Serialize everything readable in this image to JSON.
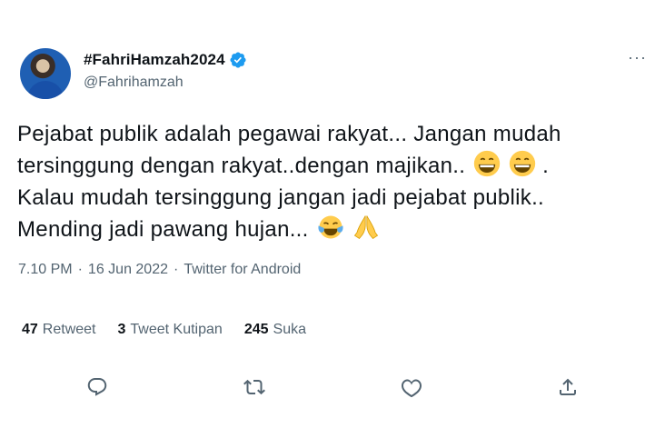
{
  "user": {
    "display_name": "#FahriHamzah2024",
    "handle": "@Fahrihamzah"
  },
  "tweet": {
    "lines": [
      "Pejabat publik adalah pegawai rakyat... Jangan mudah",
      "tersinggung dengan rakyat..dengan majikan..",
      "Kalau mudah tersinggung jangan jadi pejabat publik..",
      "Mending jadi pawang hujan..."
    ],
    "line2_suffix": "."
  },
  "meta": {
    "time": "7.10 PM",
    "sep1": "·",
    "date": "16 Jun 2022",
    "sep2": "·",
    "source": "Twitter for Android"
  },
  "stats": {
    "retweets": {
      "count": "47",
      "label": "Retweet"
    },
    "quotes": {
      "count": "3",
      "label": "Tweet Kutipan"
    },
    "likes": {
      "count": "245",
      "label": "Suka"
    }
  },
  "icons": {
    "verified": "verified-badge-icon",
    "more": "more-options-icon",
    "reply": "reply-icon",
    "retweet": "retweet-icon",
    "like": "like-icon",
    "share": "share-icon"
  },
  "colors": {
    "verified_blue": "#1d9bf0",
    "secondary_text": "#536471",
    "primary_text": "#0f1419"
  },
  "more_glyph": "···"
}
